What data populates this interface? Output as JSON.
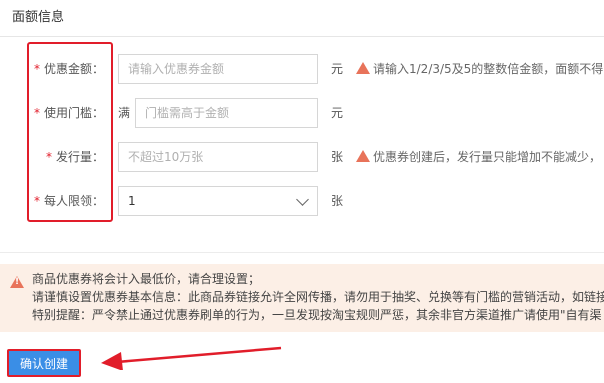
{
  "section": {
    "title": "面额信息"
  },
  "form": {
    "discount_amount": {
      "label": "优惠金额：",
      "placeholder": "请输入优惠券金额",
      "unit": "元",
      "hint": "请输入1/2/3/5及5的整数倍金额，面额不得"
    },
    "threshold": {
      "label": "使用门槛：",
      "prefix": "满",
      "placeholder": "门槛需高于金额",
      "unit": "元"
    },
    "quantity": {
      "label": "发行量：",
      "placeholder": "不超过10万张",
      "unit": "张",
      "hint": "优惠券创建后，发行量只能增加不能减少，"
    },
    "per_person_limit": {
      "label": "每人限领：",
      "value": "1",
      "unit": "张"
    },
    "required_mark": "*"
  },
  "notice": {
    "line1": "商品优惠券将会计入最低价，请合理设置；",
    "line2": "请谨慎设置优惠券基本信息：此商品券链接允许全网传播，请勿用于抽奖、兑换等有门槛的营销活动，如链接",
    "line3": "特别提醒：严令禁止通过优惠券刷单的行为，一旦发现按淘宝规则严惩，其余非官方渠道推广请使用\"自有渠"
  },
  "actions": {
    "submit_label": "确认创建"
  },
  "colors": {
    "primary": "#3a8ee6",
    "required": "#e11d2a",
    "warning": "#e8735a",
    "notice_bg": "#fcefe6"
  }
}
